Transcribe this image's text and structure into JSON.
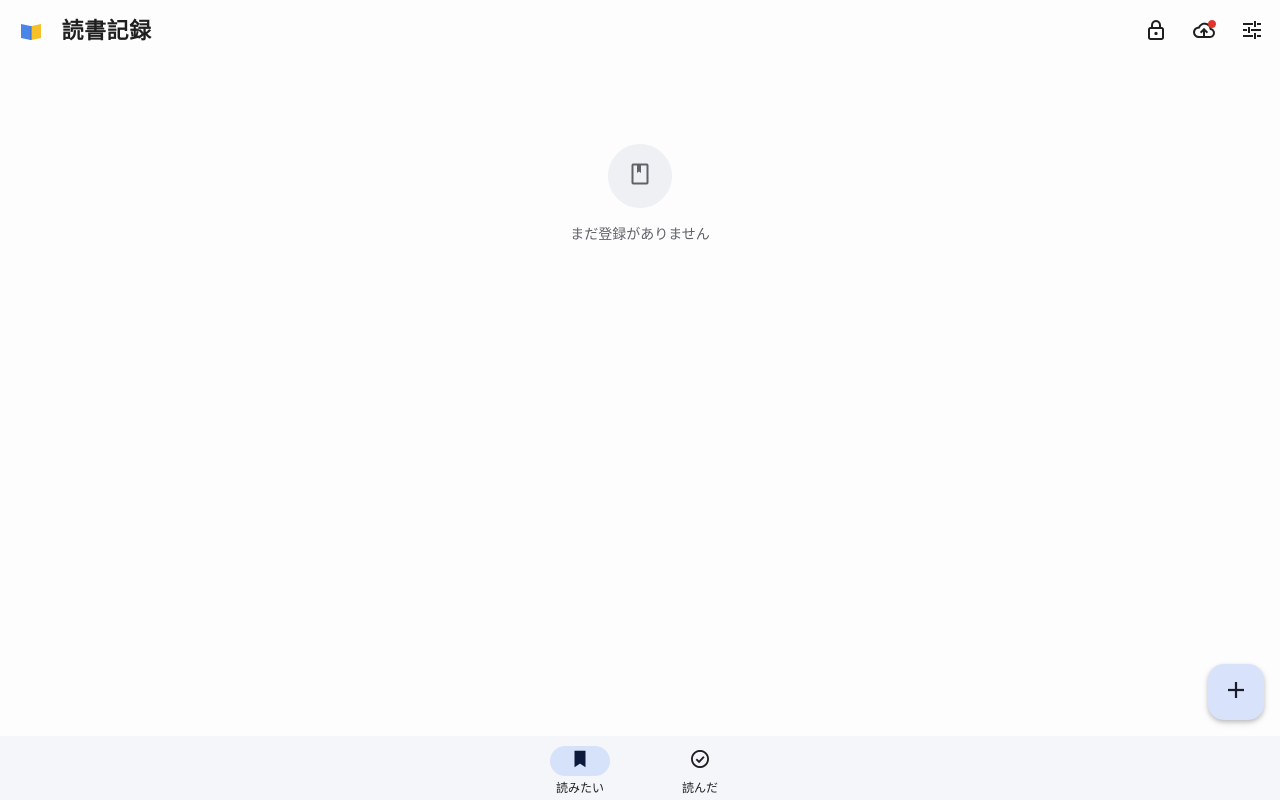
{
  "header": {
    "title": "読書記録",
    "logo_icon": "book-logo-icon",
    "actions": [
      {
        "name": "lock",
        "icon": "lock-icon"
      },
      {
        "name": "cloud-sync",
        "icon": "cloud-upload-icon",
        "has_notification": true
      },
      {
        "name": "settings",
        "icon": "tune-icon"
      }
    ]
  },
  "empty_state": {
    "icon": "book-icon",
    "message": "まだ登録がありません"
  },
  "fab": {
    "icon": "plus-icon"
  },
  "bottom_nav": {
    "items": [
      {
        "label": "読みたい",
        "icon": "bookmark-icon",
        "selected": true
      },
      {
        "label": "読んだ",
        "icon": "check-circle-icon",
        "selected": false
      }
    ]
  },
  "colors": {
    "accent_container": "#d6e2fa",
    "notification": "#e3342b",
    "logo_blue": "#4a86e8",
    "logo_yellow": "#f6c026",
    "nav_background": "#f5f6f9"
  }
}
